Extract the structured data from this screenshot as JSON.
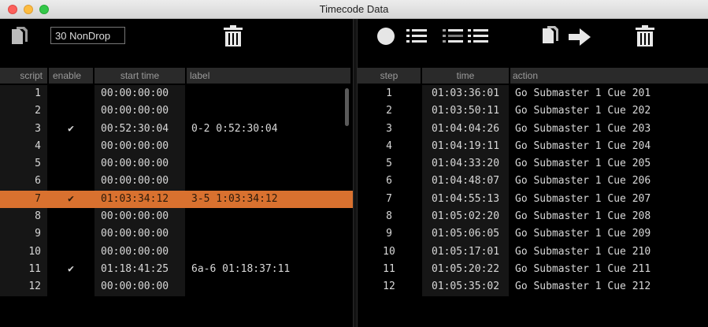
{
  "window": {
    "title": "Timecode Data"
  },
  "left_toolbar": {
    "fps_value": "30 NonDrop",
    "icons": [
      "copy-icon",
      "trash-icon"
    ]
  },
  "right_toolbar": {
    "icons": [
      "record-icon",
      "list-icon",
      "list-dim-icon",
      "list-icon",
      "copy-icon",
      "arrow-right-icon",
      "trash-icon"
    ]
  },
  "left_table": {
    "headers": {
      "script": "script",
      "enable": "enable",
      "start_time": "start time",
      "label": "label"
    },
    "rows": [
      {
        "script": "1",
        "enable": "",
        "start": "00:00:00:00",
        "label": ""
      },
      {
        "script": "2",
        "enable": "",
        "start": "00:00:00:00",
        "label": ""
      },
      {
        "script": "3",
        "enable": "✔",
        "start": "00:52:30:04",
        "label": "0-2 0:52:30:04"
      },
      {
        "script": "4",
        "enable": "",
        "start": "00:00:00:00",
        "label": ""
      },
      {
        "script": "5",
        "enable": "",
        "start": "00:00:00:00",
        "label": ""
      },
      {
        "script": "6",
        "enable": "",
        "start": "00:00:00:00",
        "label": ""
      },
      {
        "script": "7",
        "enable": "✔",
        "start": "01:03:34:12",
        "label": "3-5 1:03:34:12"
      },
      {
        "script": "8",
        "enable": "",
        "start": "00:00:00:00",
        "label": ""
      },
      {
        "script": "9",
        "enable": "",
        "start": "00:00:00:00",
        "label": ""
      },
      {
        "script": "10",
        "enable": "",
        "start": "00:00:00:00",
        "label": ""
      },
      {
        "script": "11",
        "enable": "✔",
        "start": "01:18:41:25",
        "label": "6a-6 01:18:37:11"
      },
      {
        "script": "12",
        "enable": "",
        "start": "00:00:00:00",
        "label": ""
      }
    ]
  },
  "right_table": {
    "headers": {
      "step": "step",
      "time": "time",
      "action": "action"
    },
    "rows": [
      {
        "step": "1",
        "time": "01:03:36:01",
        "action": "Go Submaster 1 Cue 201"
      },
      {
        "step": "2",
        "time": "01:03:50:11",
        "action": "Go Submaster 1 Cue 202"
      },
      {
        "step": "3",
        "time": "01:04:04:26",
        "action": "Go Submaster 1 Cue 203"
      },
      {
        "step": "4",
        "time": "01:04:19:11",
        "action": "Go Submaster 1 Cue 204"
      },
      {
        "step": "5",
        "time": "01:04:33:20",
        "action": "Go Submaster 1 Cue 205"
      },
      {
        "step": "6",
        "time": "01:04:48:07",
        "action": "Go Submaster 1 Cue 206"
      },
      {
        "step": "7",
        "time": "01:04:55:13",
        "action": "Go Submaster 1 Cue 207"
      },
      {
        "step": "8",
        "time": "01:05:02:20",
        "action": "Go Submaster 1 Cue 208"
      },
      {
        "step": "9",
        "time": "01:05:06:05",
        "action": "Go Submaster 1 Cue 209"
      },
      {
        "step": "10",
        "time": "01:05:17:01",
        "action": "Go Submaster 1 Cue 210"
      },
      {
        "step": "11",
        "time": "01:05:20:22",
        "action": "Go Submaster 1 Cue 211"
      },
      {
        "step": "12",
        "time": "01:05:35:02",
        "action": "Go Submaster 1 Cue 212"
      }
    ]
  },
  "colors": {
    "selection": "#d9712f",
    "background": "#000000",
    "header_bg": "#2a2a2a"
  }
}
